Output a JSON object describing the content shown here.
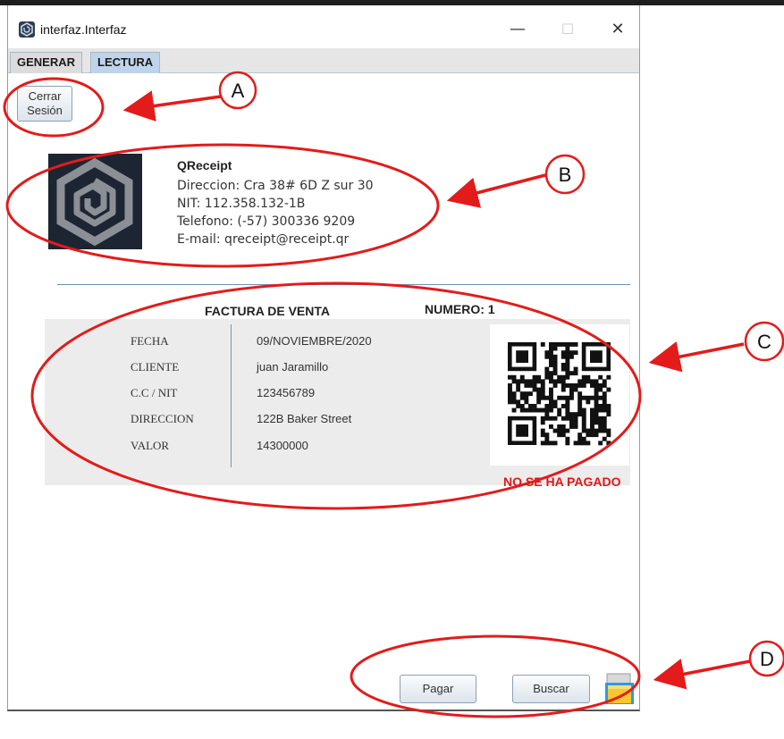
{
  "window": {
    "title": "interfaz.Interfaz",
    "minimize_glyph": "—",
    "maximize_glyph": "☐",
    "close_glyph": "✕"
  },
  "tabs": [
    {
      "label": "GENERAR",
      "selected": false
    },
    {
      "label": "LECTURA",
      "selected": true
    }
  ],
  "logout_button": {
    "line1": "Cerrar",
    "line2": "Sesión"
  },
  "company": {
    "logo_icon": "qreceipt-hexagon-logo",
    "name": "QReceipt",
    "address": "Direccion: Cra 38# 6D Z sur 30",
    "nit": "NIT: 112.358.132-1B",
    "phone": "Telefono: (-57) 300336 9209",
    "email": "E-mail: qreceipt@receipt.qr"
  },
  "invoice": {
    "title": "FACTURA DE VENTA",
    "number": "NUMERO: 1",
    "fields": [
      {
        "label": "FECHA",
        "value": "09/NOVIEMBRE/2020"
      },
      {
        "label": "CLIENTE",
        "value": "juan Jaramillo"
      },
      {
        "label": "C.C / NIT",
        "value": "123456789"
      },
      {
        "label": "DIRECCION",
        "value": "122B Baker Street"
      },
      {
        "label": "VALOR",
        "value": "14300000"
      }
    ],
    "qr_icon": "qr-code",
    "status": "NO SE HA PAGADO",
    "status_color": "#e01818"
  },
  "actions": {
    "pay_label": "Pagar",
    "search_label": "Buscar",
    "save_icon": "folder-save-icon"
  },
  "annotations": {
    "color": "#e31b1b",
    "markers": [
      {
        "letter": "A"
      },
      {
        "letter": "B"
      },
      {
        "letter": "C"
      },
      {
        "letter": "D"
      }
    ]
  }
}
